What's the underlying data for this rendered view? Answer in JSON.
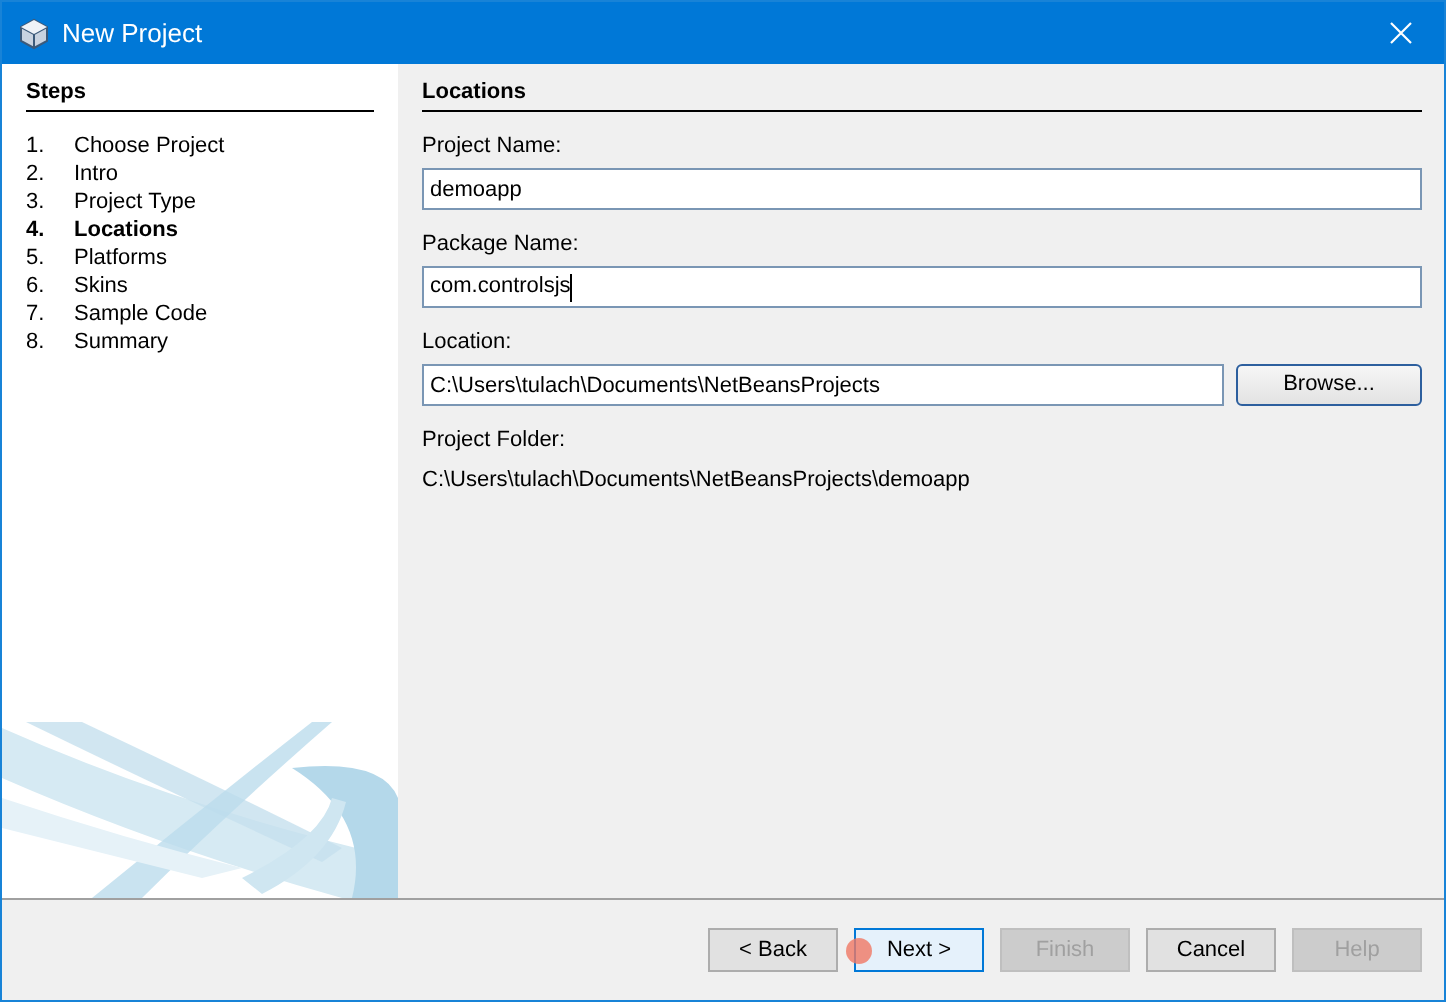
{
  "window": {
    "title": "New Project"
  },
  "steps": {
    "title": "Steps",
    "items": [
      {
        "number": "1.",
        "label": "Choose Project",
        "selected": false
      },
      {
        "number": "2.",
        "label": "Intro",
        "selected": false
      },
      {
        "number": "3.",
        "label": "Project Type",
        "selected": false
      },
      {
        "number": "4.",
        "label": "Locations",
        "selected": true
      },
      {
        "number": "5.",
        "label": "Platforms",
        "selected": false
      },
      {
        "number": "6.",
        "label": "Skins",
        "selected": false
      },
      {
        "number": "7.",
        "label": "Sample Code",
        "selected": false
      },
      {
        "number": "8.",
        "label": "Summary",
        "selected": false
      }
    ]
  },
  "panel": {
    "title": "Locations",
    "fields": [
      {
        "label": "Project Name:",
        "value": "demoapp",
        "focused": false
      },
      {
        "label": "Package Name:",
        "value": "com.controlsjs",
        "focused": true
      },
      {
        "label": "Location:",
        "value": "C:\\Users\\tulach\\Documents\\NetBeansProjects",
        "focused": false,
        "button": "Browse..."
      }
    ],
    "folder_label": "Project Folder:",
    "folder_value": "C:\\Users\\tulach\\Documents\\NetBeansProjects\\demoapp"
  },
  "buttons": [
    {
      "label": "< Back",
      "disabled": false,
      "default": false,
      "clicked": false
    },
    {
      "label": "Next >",
      "disabled": false,
      "default": true,
      "clicked": true
    },
    {
      "label": "Finish",
      "disabled": true,
      "default": false,
      "clicked": false
    },
    {
      "label": "Cancel",
      "disabled": false,
      "default": false,
      "clicked": false
    },
    {
      "label": "Help",
      "disabled": true,
      "default": false,
      "clicked": false
    }
  ]
}
